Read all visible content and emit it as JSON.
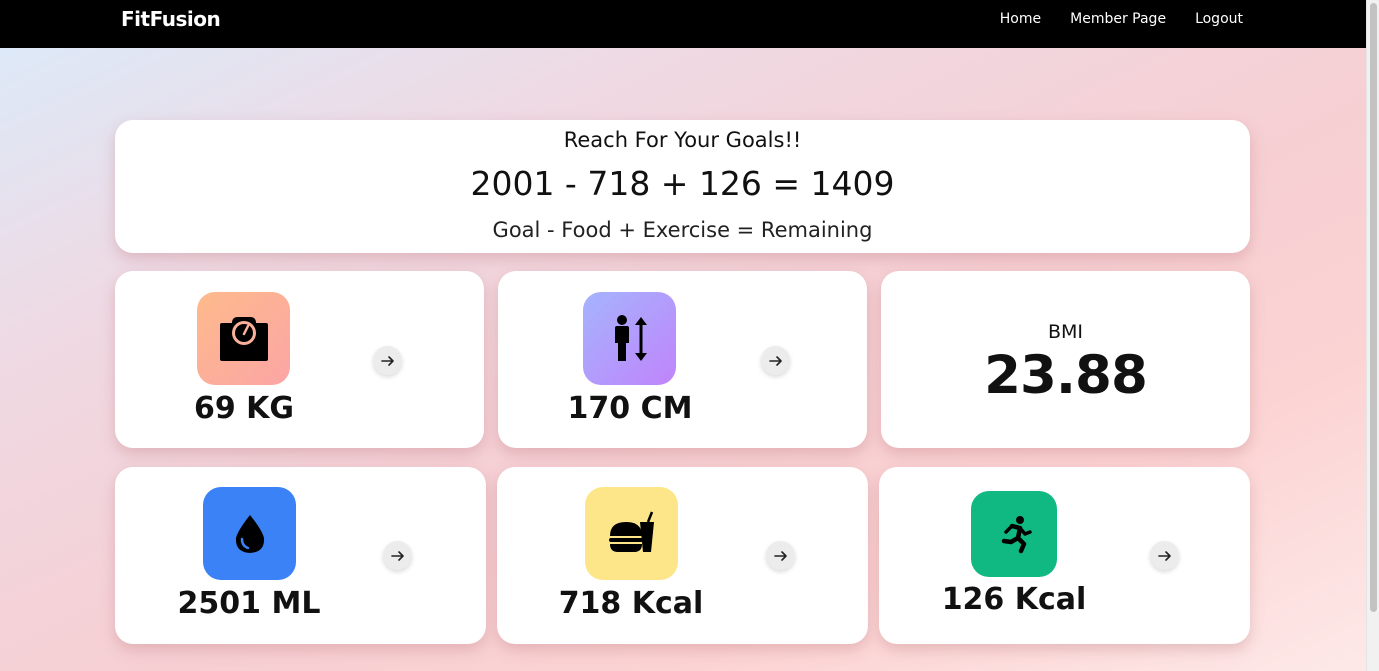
{
  "navbar": {
    "brand": "FitFusion",
    "links": [
      "Home",
      "Member Page",
      "Logout"
    ]
  },
  "goal": {
    "title": "Reach For Your Goals!!",
    "equation": "2001 - 718 + 126 = 1409",
    "legend": "Goal - Food + Exercise = Remaining"
  },
  "stats": {
    "weight": {
      "value": "69 KG",
      "icon": "weight-scale-icon",
      "color_from": "#fdba8c",
      "color_to": "#fca5a5"
    },
    "height": {
      "value": "170 CM",
      "icon": "person-height-icon",
      "color_from": "#a5b4fc",
      "color_to": "#c084fc"
    },
    "bmi": {
      "label": "BMI",
      "value": "23.88"
    },
    "water": {
      "value": "2501 ML",
      "icon": "water-drop-icon",
      "color": "#3b82f6"
    },
    "food": {
      "value": "718 Kcal",
      "icon": "burger-drink-icon",
      "color": "#fde68a"
    },
    "exercise": {
      "value": "126 Kcal",
      "icon": "running-person-icon",
      "color": "#10b981"
    }
  }
}
